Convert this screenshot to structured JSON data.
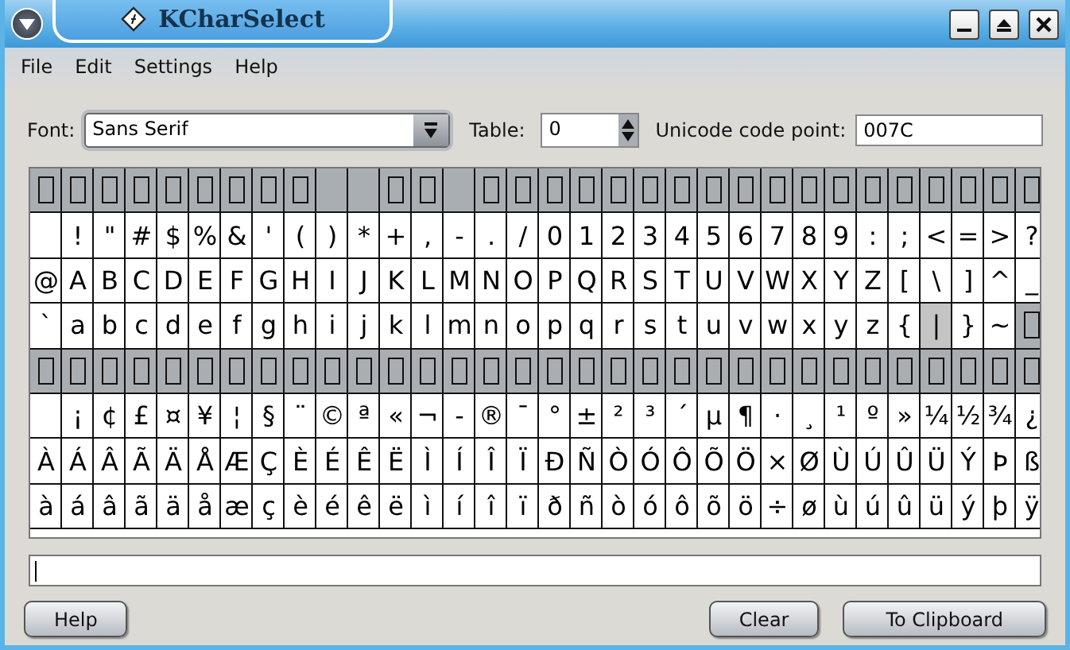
{
  "window": {
    "title": "KCharSelect"
  },
  "menu": [
    "File",
    "Edit",
    "Settings",
    "Help"
  ],
  "toolbar": {
    "font_label": "Font:",
    "font": "Sans Serif",
    "table_label": "Table:",
    "table": "0",
    "code_point_label": "Unicode code point:",
    "code_point": "007C"
  },
  "grid": [
    {
      "cells": [
        {
          "kind": "missing",
          "selected": false
        },
        {
          "kind": "missing",
          "selected": false
        },
        {
          "kind": "missing",
          "selected": false
        },
        {
          "kind": "missing",
          "selected": false
        },
        {
          "kind": "missing",
          "selected": false
        },
        {
          "kind": "missing",
          "selected": false
        },
        {
          "kind": "missing",
          "selected": false
        },
        {
          "kind": "missing",
          "selected": false
        },
        {
          "kind": "missing",
          "selected": false
        },
        {
          "kind": "empty",
          "selected": false
        },
        {
          "kind": "empty",
          "selected": false
        },
        {
          "kind": "missing",
          "selected": false
        },
        {
          "kind": "missing",
          "selected": false
        },
        {
          "kind": "empty",
          "selected": false
        },
        {
          "kind": "missing",
          "selected": false
        },
        {
          "kind": "missing",
          "selected": false
        },
        {
          "kind": "missing",
          "selected": false
        },
        {
          "kind": "missing",
          "selected": false
        },
        {
          "kind": "missing",
          "selected": false
        },
        {
          "kind": "missing",
          "selected": false
        },
        {
          "kind": "missing",
          "selected": false
        },
        {
          "kind": "missing",
          "selected": false
        },
        {
          "kind": "missing",
          "selected": false
        },
        {
          "kind": "missing",
          "selected": false
        },
        {
          "kind": "missing",
          "selected": false
        },
        {
          "kind": "missing",
          "selected": false
        },
        {
          "kind": "missing",
          "selected": false
        },
        {
          "kind": "missing",
          "selected": false
        },
        {
          "kind": "missing",
          "selected": false
        },
        {
          "kind": "missing",
          "selected": false
        },
        {
          "kind": "missing",
          "selected": false
        },
        {
          "kind": "missing",
          "selected": false
        }
      ]
    },
    {
      "cells": [
        {
          "kind": "space",
          "selected": false
        },
        {
          "kind": "char",
          "text": "!",
          "selected": false
        },
        {
          "kind": "char",
          "text": "\"",
          "selected": false
        },
        {
          "kind": "char",
          "text": "#",
          "selected": false
        },
        {
          "kind": "char",
          "text": "$",
          "selected": false
        },
        {
          "kind": "char",
          "text": "%",
          "selected": false
        },
        {
          "kind": "char",
          "text": "&",
          "selected": false
        },
        {
          "kind": "char",
          "text": "'",
          "selected": false
        },
        {
          "kind": "char",
          "text": "(",
          "selected": false
        },
        {
          "kind": "char",
          "text": ")",
          "selected": false
        },
        {
          "kind": "char",
          "text": "*",
          "selected": false
        },
        {
          "kind": "char",
          "text": "+",
          "selected": false
        },
        {
          "kind": "char",
          "text": ",",
          "selected": false
        },
        {
          "kind": "char",
          "text": "-",
          "selected": false
        },
        {
          "kind": "char",
          "text": ".",
          "selected": false
        },
        {
          "kind": "char",
          "text": "/",
          "selected": false
        },
        {
          "kind": "char",
          "text": "0",
          "selected": false
        },
        {
          "kind": "char",
          "text": "1",
          "selected": false
        },
        {
          "kind": "char",
          "text": "2",
          "selected": false
        },
        {
          "kind": "char",
          "text": "3",
          "selected": false
        },
        {
          "kind": "char",
          "text": "4",
          "selected": false
        },
        {
          "kind": "char",
          "text": "5",
          "selected": false
        },
        {
          "kind": "char",
          "text": "6",
          "selected": false
        },
        {
          "kind": "char",
          "text": "7",
          "selected": false
        },
        {
          "kind": "char",
          "text": "8",
          "selected": false
        },
        {
          "kind": "char",
          "text": "9",
          "selected": false
        },
        {
          "kind": "char",
          "text": ":",
          "selected": false
        },
        {
          "kind": "char",
          "text": ";",
          "selected": false
        },
        {
          "kind": "char",
          "text": "<",
          "selected": false
        },
        {
          "kind": "char",
          "text": "=",
          "selected": false
        },
        {
          "kind": "char",
          "text": ">",
          "selected": false
        },
        {
          "kind": "char",
          "text": "?",
          "selected": false
        }
      ]
    },
    {
      "cells": [
        {
          "kind": "char",
          "text": "@",
          "selected": false
        },
        {
          "kind": "char",
          "text": "A",
          "selected": false
        },
        {
          "kind": "char",
          "text": "B",
          "selected": false
        },
        {
          "kind": "char",
          "text": "C",
          "selected": false
        },
        {
          "kind": "char",
          "text": "D",
          "selected": false
        },
        {
          "kind": "char",
          "text": "E",
          "selected": false
        },
        {
          "kind": "char",
          "text": "F",
          "selected": false
        },
        {
          "kind": "char",
          "text": "G",
          "selected": false
        },
        {
          "kind": "char",
          "text": "H",
          "selected": false
        },
        {
          "kind": "char",
          "text": "I",
          "selected": false
        },
        {
          "kind": "char",
          "text": "J",
          "selected": false
        },
        {
          "kind": "char",
          "text": "K",
          "selected": false
        },
        {
          "kind": "char",
          "text": "L",
          "selected": false
        },
        {
          "kind": "char",
          "text": "M",
          "selected": false
        },
        {
          "kind": "char",
          "text": "N",
          "selected": false
        },
        {
          "kind": "char",
          "text": "O",
          "selected": false
        },
        {
          "kind": "char",
          "text": "P",
          "selected": false
        },
        {
          "kind": "char",
          "text": "Q",
          "selected": false
        },
        {
          "kind": "char",
          "text": "R",
          "selected": false
        },
        {
          "kind": "char",
          "text": "S",
          "selected": false
        },
        {
          "kind": "char",
          "text": "T",
          "selected": false
        },
        {
          "kind": "char",
          "text": "U",
          "selected": false
        },
        {
          "kind": "char",
          "text": "V",
          "selected": false
        },
        {
          "kind": "char",
          "text": "W",
          "selected": false
        },
        {
          "kind": "char",
          "text": "X",
          "selected": false
        },
        {
          "kind": "char",
          "text": "Y",
          "selected": false
        },
        {
          "kind": "char",
          "text": "Z",
          "selected": false
        },
        {
          "kind": "char",
          "text": "[",
          "selected": false
        },
        {
          "kind": "char",
          "text": "\\",
          "selected": false
        },
        {
          "kind": "char",
          "text": "]",
          "selected": false
        },
        {
          "kind": "char",
          "text": "^",
          "selected": false
        },
        {
          "kind": "char",
          "text": "_",
          "selected": false
        }
      ]
    },
    {
      "cells": [
        {
          "kind": "char",
          "text": "`",
          "selected": false
        },
        {
          "kind": "char",
          "text": "a",
          "selected": false
        },
        {
          "kind": "char",
          "text": "b",
          "selected": false
        },
        {
          "kind": "char",
          "text": "c",
          "selected": false
        },
        {
          "kind": "char",
          "text": "d",
          "selected": false
        },
        {
          "kind": "char",
          "text": "e",
          "selected": false
        },
        {
          "kind": "char",
          "text": "f",
          "selected": false
        },
        {
          "kind": "char",
          "text": "g",
          "selected": false
        },
        {
          "kind": "char",
          "text": "h",
          "selected": false
        },
        {
          "kind": "char",
          "text": "i",
          "selected": false
        },
        {
          "kind": "char",
          "text": "j",
          "selected": false
        },
        {
          "kind": "char",
          "text": "k",
          "selected": false
        },
        {
          "kind": "char",
          "text": "l",
          "selected": false
        },
        {
          "kind": "char",
          "text": "m",
          "selected": false
        },
        {
          "kind": "char",
          "text": "n",
          "selected": false
        },
        {
          "kind": "char",
          "text": "o",
          "selected": false
        },
        {
          "kind": "char",
          "text": "p",
          "selected": false
        },
        {
          "kind": "char",
          "text": "q",
          "selected": false
        },
        {
          "kind": "char",
          "text": "r",
          "selected": false
        },
        {
          "kind": "char",
          "text": "s",
          "selected": false
        },
        {
          "kind": "char",
          "text": "t",
          "selected": false
        },
        {
          "kind": "char",
          "text": "u",
          "selected": false
        },
        {
          "kind": "char",
          "text": "v",
          "selected": false
        },
        {
          "kind": "char",
          "text": "w",
          "selected": false
        },
        {
          "kind": "char",
          "text": "x",
          "selected": false
        },
        {
          "kind": "char",
          "text": "y",
          "selected": false
        },
        {
          "kind": "char",
          "text": "z",
          "selected": false
        },
        {
          "kind": "char",
          "text": "{",
          "selected": false
        },
        {
          "kind": "char",
          "text": "|",
          "selected": true
        },
        {
          "kind": "char",
          "text": "}",
          "selected": false
        },
        {
          "kind": "char",
          "text": "~",
          "selected": false
        },
        {
          "kind": "missing",
          "selected": false
        }
      ]
    },
    {
      "cells": [
        {
          "kind": "missing",
          "selected": false
        },
        {
          "kind": "missing",
          "selected": false
        },
        {
          "kind": "missing",
          "selected": false
        },
        {
          "kind": "missing",
          "selected": false
        },
        {
          "kind": "missing",
          "selected": false
        },
        {
          "kind": "missing",
          "selected": false
        },
        {
          "kind": "missing",
          "selected": false
        },
        {
          "kind": "missing",
          "selected": false
        },
        {
          "kind": "missing",
          "selected": false
        },
        {
          "kind": "missing",
          "selected": false
        },
        {
          "kind": "missing",
          "selected": false
        },
        {
          "kind": "missing",
          "selected": false
        },
        {
          "kind": "missing",
          "selected": false
        },
        {
          "kind": "missing",
          "selected": false
        },
        {
          "kind": "missing",
          "selected": false
        },
        {
          "kind": "missing",
          "selected": false
        },
        {
          "kind": "missing",
          "selected": false
        },
        {
          "kind": "missing",
          "selected": false
        },
        {
          "kind": "missing",
          "selected": false
        },
        {
          "kind": "missing",
          "selected": false
        },
        {
          "kind": "missing",
          "selected": false
        },
        {
          "kind": "missing",
          "selected": false
        },
        {
          "kind": "missing",
          "selected": false
        },
        {
          "kind": "missing",
          "selected": false
        },
        {
          "kind": "missing",
          "selected": false
        },
        {
          "kind": "missing",
          "selected": false
        },
        {
          "kind": "missing",
          "selected": false
        },
        {
          "kind": "missing",
          "selected": false
        },
        {
          "kind": "missing",
          "selected": false
        },
        {
          "kind": "missing",
          "selected": false
        },
        {
          "kind": "missing",
          "selected": false
        },
        {
          "kind": "missing",
          "selected": false
        }
      ]
    },
    {
      "cells": [
        {
          "kind": "space",
          "selected": false
        },
        {
          "kind": "char",
          "text": "¡",
          "selected": false
        },
        {
          "kind": "char",
          "text": "¢",
          "selected": false
        },
        {
          "kind": "char",
          "text": "£",
          "selected": false
        },
        {
          "kind": "char",
          "text": "¤",
          "selected": false
        },
        {
          "kind": "char",
          "text": "¥",
          "selected": false
        },
        {
          "kind": "char",
          "text": "¦",
          "selected": false
        },
        {
          "kind": "char",
          "text": "§",
          "selected": false
        },
        {
          "kind": "char",
          "text": "¨",
          "selected": false
        },
        {
          "kind": "char",
          "text": "©",
          "selected": false
        },
        {
          "kind": "char",
          "text": "ª",
          "selected": false
        },
        {
          "kind": "char",
          "text": "«",
          "selected": false
        },
        {
          "kind": "char",
          "text": "¬",
          "selected": false
        },
        {
          "kind": "char",
          "text": "-",
          "selected": false
        },
        {
          "kind": "char",
          "text": "®",
          "selected": false
        },
        {
          "kind": "char",
          "text": "¯",
          "selected": false
        },
        {
          "kind": "char",
          "text": "°",
          "selected": false
        },
        {
          "kind": "char",
          "text": "±",
          "selected": false
        },
        {
          "kind": "char",
          "text": "²",
          "selected": false
        },
        {
          "kind": "char",
          "text": "³",
          "selected": false
        },
        {
          "kind": "char",
          "text": "´",
          "selected": false
        },
        {
          "kind": "char",
          "text": "µ",
          "selected": false
        },
        {
          "kind": "char",
          "text": "¶",
          "selected": false
        },
        {
          "kind": "char",
          "text": "·",
          "selected": false
        },
        {
          "kind": "char",
          "text": "¸",
          "selected": false
        },
        {
          "kind": "char",
          "text": "¹",
          "selected": false
        },
        {
          "kind": "char",
          "text": "º",
          "selected": false
        },
        {
          "kind": "char",
          "text": "»",
          "selected": false
        },
        {
          "kind": "char",
          "text": "¼",
          "selected": false
        },
        {
          "kind": "char",
          "text": "½",
          "selected": false
        },
        {
          "kind": "char",
          "text": "¾",
          "selected": false
        },
        {
          "kind": "char",
          "text": "¿",
          "selected": false
        }
      ]
    },
    {
      "cells": [
        {
          "kind": "char",
          "text": "À",
          "selected": false
        },
        {
          "kind": "char",
          "text": "Á",
          "selected": false
        },
        {
          "kind": "char",
          "text": "Â",
          "selected": false
        },
        {
          "kind": "char",
          "text": "Ã",
          "selected": false
        },
        {
          "kind": "char",
          "text": "Ä",
          "selected": false
        },
        {
          "kind": "char",
          "text": "Å",
          "selected": false
        },
        {
          "kind": "char",
          "text": "Æ",
          "selected": false
        },
        {
          "kind": "char",
          "text": "Ç",
          "selected": false
        },
        {
          "kind": "char",
          "text": "È",
          "selected": false
        },
        {
          "kind": "char",
          "text": "É",
          "selected": false
        },
        {
          "kind": "char",
          "text": "Ê",
          "selected": false
        },
        {
          "kind": "char",
          "text": "Ë",
          "selected": false
        },
        {
          "kind": "char",
          "text": "Ì",
          "selected": false
        },
        {
          "kind": "char",
          "text": "Í",
          "selected": false
        },
        {
          "kind": "char",
          "text": "Î",
          "selected": false
        },
        {
          "kind": "char",
          "text": "Ï",
          "selected": false
        },
        {
          "kind": "char",
          "text": "Ð",
          "selected": false
        },
        {
          "kind": "char",
          "text": "Ñ",
          "selected": false
        },
        {
          "kind": "char",
          "text": "Ò",
          "selected": false
        },
        {
          "kind": "char",
          "text": "Ó",
          "selected": false
        },
        {
          "kind": "char",
          "text": "Ô",
          "selected": false
        },
        {
          "kind": "char",
          "text": "Õ",
          "selected": false
        },
        {
          "kind": "char",
          "text": "Ö",
          "selected": false
        },
        {
          "kind": "char",
          "text": "×",
          "selected": false
        },
        {
          "kind": "char",
          "text": "Ø",
          "selected": false
        },
        {
          "kind": "char",
          "text": "Ù",
          "selected": false
        },
        {
          "kind": "char",
          "text": "Ú",
          "selected": false
        },
        {
          "kind": "char",
          "text": "Û",
          "selected": false
        },
        {
          "kind": "char",
          "text": "Ü",
          "selected": false
        },
        {
          "kind": "char",
          "text": "Ý",
          "selected": false
        },
        {
          "kind": "char",
          "text": "Þ",
          "selected": false
        },
        {
          "kind": "char",
          "text": "ß",
          "selected": false
        }
      ]
    },
    {
      "cells": [
        {
          "kind": "char",
          "text": "à",
          "selected": false
        },
        {
          "kind": "char",
          "text": "á",
          "selected": false
        },
        {
          "kind": "char",
          "text": "â",
          "selected": false
        },
        {
          "kind": "char",
          "text": "ã",
          "selected": false
        },
        {
          "kind": "char",
          "text": "ä",
          "selected": false
        },
        {
          "kind": "char",
          "text": "å",
          "selected": false
        },
        {
          "kind": "char",
          "text": "æ",
          "selected": false
        },
        {
          "kind": "char",
          "text": "ç",
          "selected": false
        },
        {
          "kind": "char",
          "text": "è",
          "selected": false
        },
        {
          "kind": "char",
          "text": "é",
          "selected": false
        },
        {
          "kind": "char",
          "text": "ê",
          "selected": false
        },
        {
          "kind": "char",
          "text": "ë",
          "selected": false
        },
        {
          "kind": "char",
          "text": "ì",
          "selected": false
        },
        {
          "kind": "char",
          "text": "í",
          "selected": false
        },
        {
          "kind": "char",
          "text": "î",
          "selected": false
        },
        {
          "kind": "char",
          "text": "ï",
          "selected": false
        },
        {
          "kind": "char",
          "text": "ð",
          "selected": false
        },
        {
          "kind": "char",
          "text": "ñ",
          "selected": false
        },
        {
          "kind": "char",
          "text": "ò",
          "selected": false
        },
        {
          "kind": "char",
          "text": "ó",
          "selected": false
        },
        {
          "kind": "char",
          "text": "ô",
          "selected": false
        },
        {
          "kind": "char",
          "text": "õ",
          "selected": false
        },
        {
          "kind": "char",
          "text": "ö",
          "selected": false
        },
        {
          "kind": "char",
          "text": "÷",
          "selected": false
        },
        {
          "kind": "char",
          "text": "ø",
          "selected": false
        },
        {
          "kind": "char",
          "text": "ù",
          "selected": false
        },
        {
          "kind": "char",
          "text": "ú",
          "selected": false
        },
        {
          "kind": "char",
          "text": "û",
          "selected": false
        },
        {
          "kind": "char",
          "text": "ü",
          "selected": false
        },
        {
          "kind": "char",
          "text": "ý",
          "selected": false
        },
        {
          "kind": "char",
          "text": "þ",
          "selected": false
        },
        {
          "kind": "char",
          "text": "ÿ",
          "selected": false
        }
      ]
    }
  ],
  "buttons": {
    "help": "Help",
    "clear": "Clear",
    "clipboard": "To Clipboard"
  }
}
